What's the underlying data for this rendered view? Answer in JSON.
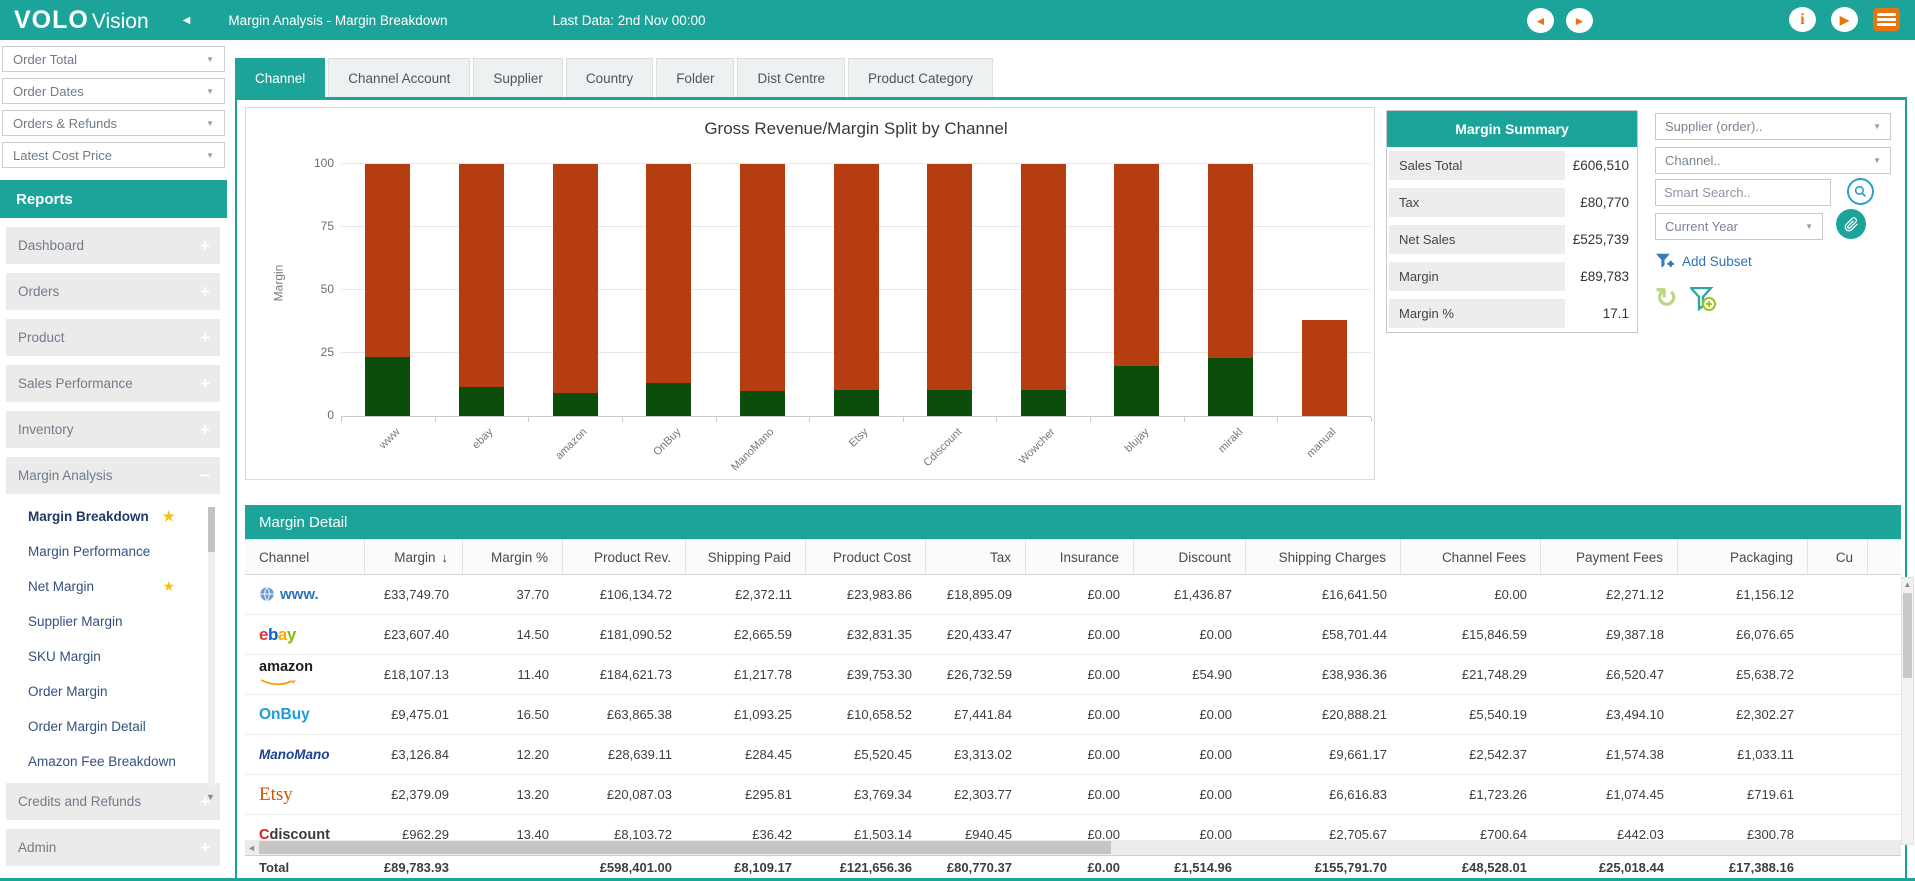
{
  "colors": {
    "teal": "#1CA49B",
    "orange": "#E8740E",
    "chart_red": "#B63C12",
    "chart_green": "#0B4D0B",
    "star_gold": "#F2C21C",
    "link_blue": "#2E74B5"
  },
  "topbar": {
    "logo_bold": "VOLO",
    "logo_light": "Vision",
    "title": "Margin Analysis - Margin Breakdown",
    "last_data": "Last Data: 2nd Nov 00:00",
    "icons": [
      "back-arrow",
      "forward-arrow",
      "info",
      "play",
      "menu-list"
    ]
  },
  "sidebar": {
    "filters": [
      "Order Total",
      "Order Dates",
      "Orders & Refunds",
      "Latest Cost Price"
    ],
    "reports_label": "Reports",
    "sections": [
      {
        "label": "Dashboard",
        "expanded": false
      },
      {
        "label": "Orders",
        "expanded": false
      },
      {
        "label": "Product",
        "expanded": false
      },
      {
        "label": "Sales Performance",
        "expanded": false
      },
      {
        "label": "Inventory",
        "expanded": false
      },
      {
        "label": "Margin Analysis",
        "expanded": true
      }
    ],
    "margin_items": [
      {
        "label": "Margin Breakdown",
        "active": true,
        "starred": true
      },
      {
        "label": "Margin Performance",
        "active": false,
        "starred": false
      },
      {
        "label": "Net Margin",
        "active": false,
        "starred": true
      },
      {
        "label": "Supplier Margin",
        "active": false,
        "starred": false
      },
      {
        "label": "SKU Margin",
        "active": false,
        "starred": false
      },
      {
        "label": "Order Margin",
        "active": false,
        "starred": false
      },
      {
        "label": "Order Margin Detail",
        "active": false,
        "starred": false
      },
      {
        "label": "Amazon Fee Breakdown",
        "active": false,
        "starred": false
      }
    ],
    "sections_bottom": [
      {
        "label": "Credits and Refunds"
      },
      {
        "label": "Admin"
      }
    ]
  },
  "tabs": {
    "active": "Channel",
    "items": [
      "Channel",
      "Channel Account",
      "Supplier",
      "Country",
      "Folder",
      "Dist Centre",
      "Product Category"
    ]
  },
  "chart_data": {
    "type": "bar",
    "stacked": true,
    "title": "Gross Revenue/Margin Split by Channel",
    "xlabel": "",
    "ylabel": "Margin",
    "ylim": [
      0,
      100
    ],
    "yticks": [
      0,
      25,
      50,
      75,
      100
    ],
    "grid": true,
    "legend": false,
    "categories": [
      "www",
      "ebay",
      "amazon",
      "OnBuy",
      "ManoMano",
      "Etsy",
      "Cdiscount",
      "Wowcher",
      "blujay",
      "mirakl",
      "manual"
    ],
    "series": [
      {
        "name": "Margin",
        "color": "#0B4D0B",
        "values": [
          23.5,
          11.5,
          9,
          13,
          10,
          10.5,
          10.5,
          10.5,
          20,
          23,
          0
        ]
      },
      {
        "name": "Gross Revenue",
        "color": "#B63C12",
        "values": [
          76.5,
          88.5,
          91,
          87,
          90,
          89.5,
          89.5,
          89.5,
          80,
          77,
          38
        ]
      }
    ],
    "bar_totals": [
      100,
      100,
      100,
      100,
      100,
      100,
      100,
      100,
      100,
      100,
      38
    ]
  },
  "margin_summary": {
    "title": "Margin Summary",
    "rows": [
      {
        "label": "Sales Total",
        "value": "£606,510"
      },
      {
        "label": "Tax",
        "value": "£80,770"
      },
      {
        "label": "Net Sales",
        "value": "£525,739"
      },
      {
        "label": "Margin",
        "value": "£89,783"
      },
      {
        "label": "Margin %",
        "value": "17.1"
      }
    ]
  },
  "filter_panel": {
    "supplier_dropdown": "Supplier (order)..",
    "channel_dropdown": "Channel..",
    "smart_search_placeholder": "Smart Search..",
    "period_dropdown": "Current Year",
    "add_subset_label": "Add Subset"
  },
  "margin_detail": {
    "title": "Margin Detail",
    "sort_indicator": "↓",
    "columns": [
      "Channel",
      "Margin",
      "Margin %",
      "Product Rev.",
      "Shipping Paid",
      "Product Cost",
      "Tax",
      "Insurance",
      "Discount",
      "Shipping Charges",
      "Channel Fees",
      "Payment Fees",
      "Packaging",
      "Cu"
    ],
    "rows": [
      {
        "id": "www",
        "logo": "www.",
        "values": [
          "£33,749.70",
          "37.70",
          "£106,134.72",
          "£2,372.11",
          "£23,983.86",
          "£18,895.09",
          "£0.00",
          "£1,436.87",
          "£16,641.50",
          "£0.00",
          "£2,271.12",
          "£1,156.12"
        ]
      },
      {
        "id": "ebay",
        "logo": "ebay",
        "values": [
          "£23,607.40",
          "14.50",
          "£181,090.52",
          "£2,665.59",
          "£32,831.35",
          "£20,433.47",
          "£0.00",
          "£0.00",
          "£58,701.44",
          "£15,846.59",
          "£9,387.18",
          "£6,076.65"
        ]
      },
      {
        "id": "amazon",
        "logo": "amazon",
        "values": [
          "£18,107.13",
          "11.40",
          "£184,621.73",
          "£1,217.78",
          "£39,753.30",
          "£26,732.59",
          "£0.00",
          "£54.90",
          "£38,936.36",
          "£21,748.29",
          "£6,520.47",
          "£5,638.72"
        ]
      },
      {
        "id": "onbuy",
        "logo": "OnBuy",
        "values": [
          "£9,475.01",
          "16.50",
          "£63,865.38",
          "£1,093.25",
          "£10,658.52",
          "£7,441.84",
          "£0.00",
          "£0.00",
          "£20,888.21",
          "£5,540.19",
          "£3,494.10",
          "£2,302.27"
        ]
      },
      {
        "id": "manomano",
        "logo": "ManoMano",
        "values": [
          "£3,126.84",
          "12.20",
          "£28,639.11",
          "£284.45",
          "£5,520.45",
          "£3,313.02",
          "£0.00",
          "£0.00",
          "£9,661.17",
          "£2,542.37",
          "£1,574.38",
          "£1,033.11"
        ]
      },
      {
        "id": "etsy",
        "logo": "Etsy",
        "values": [
          "£2,379.09",
          "13.20",
          "£20,087.03",
          "£295.81",
          "£3,769.34",
          "£2,303.77",
          "£0.00",
          "£0.00",
          "£6,616.83",
          "£1,723.26",
          "£1,074.45",
          "£719.61"
        ]
      },
      {
        "id": "cdiscount",
        "logo": "Cdiscount",
        "values": [
          "£962.29",
          "13.40",
          "£8,103.72",
          "£36.42",
          "£1,503.14",
          "£940.45",
          "£0.00",
          "£0.00",
          "£2,705.67",
          "£700.64",
          "£442.03",
          "£300.78"
        ]
      }
    ],
    "total": {
      "label": "Total",
      "values": [
        "£89,783.93",
        "",
        "£598,401.00",
        "£8,109.17",
        "£121,656.36",
        "£80,770.37",
        "£0.00",
        "£1,514.96",
        "£155,791.70",
        "£48,528.01",
        "£25,018.44",
        "£17,388.16"
      ]
    }
  }
}
